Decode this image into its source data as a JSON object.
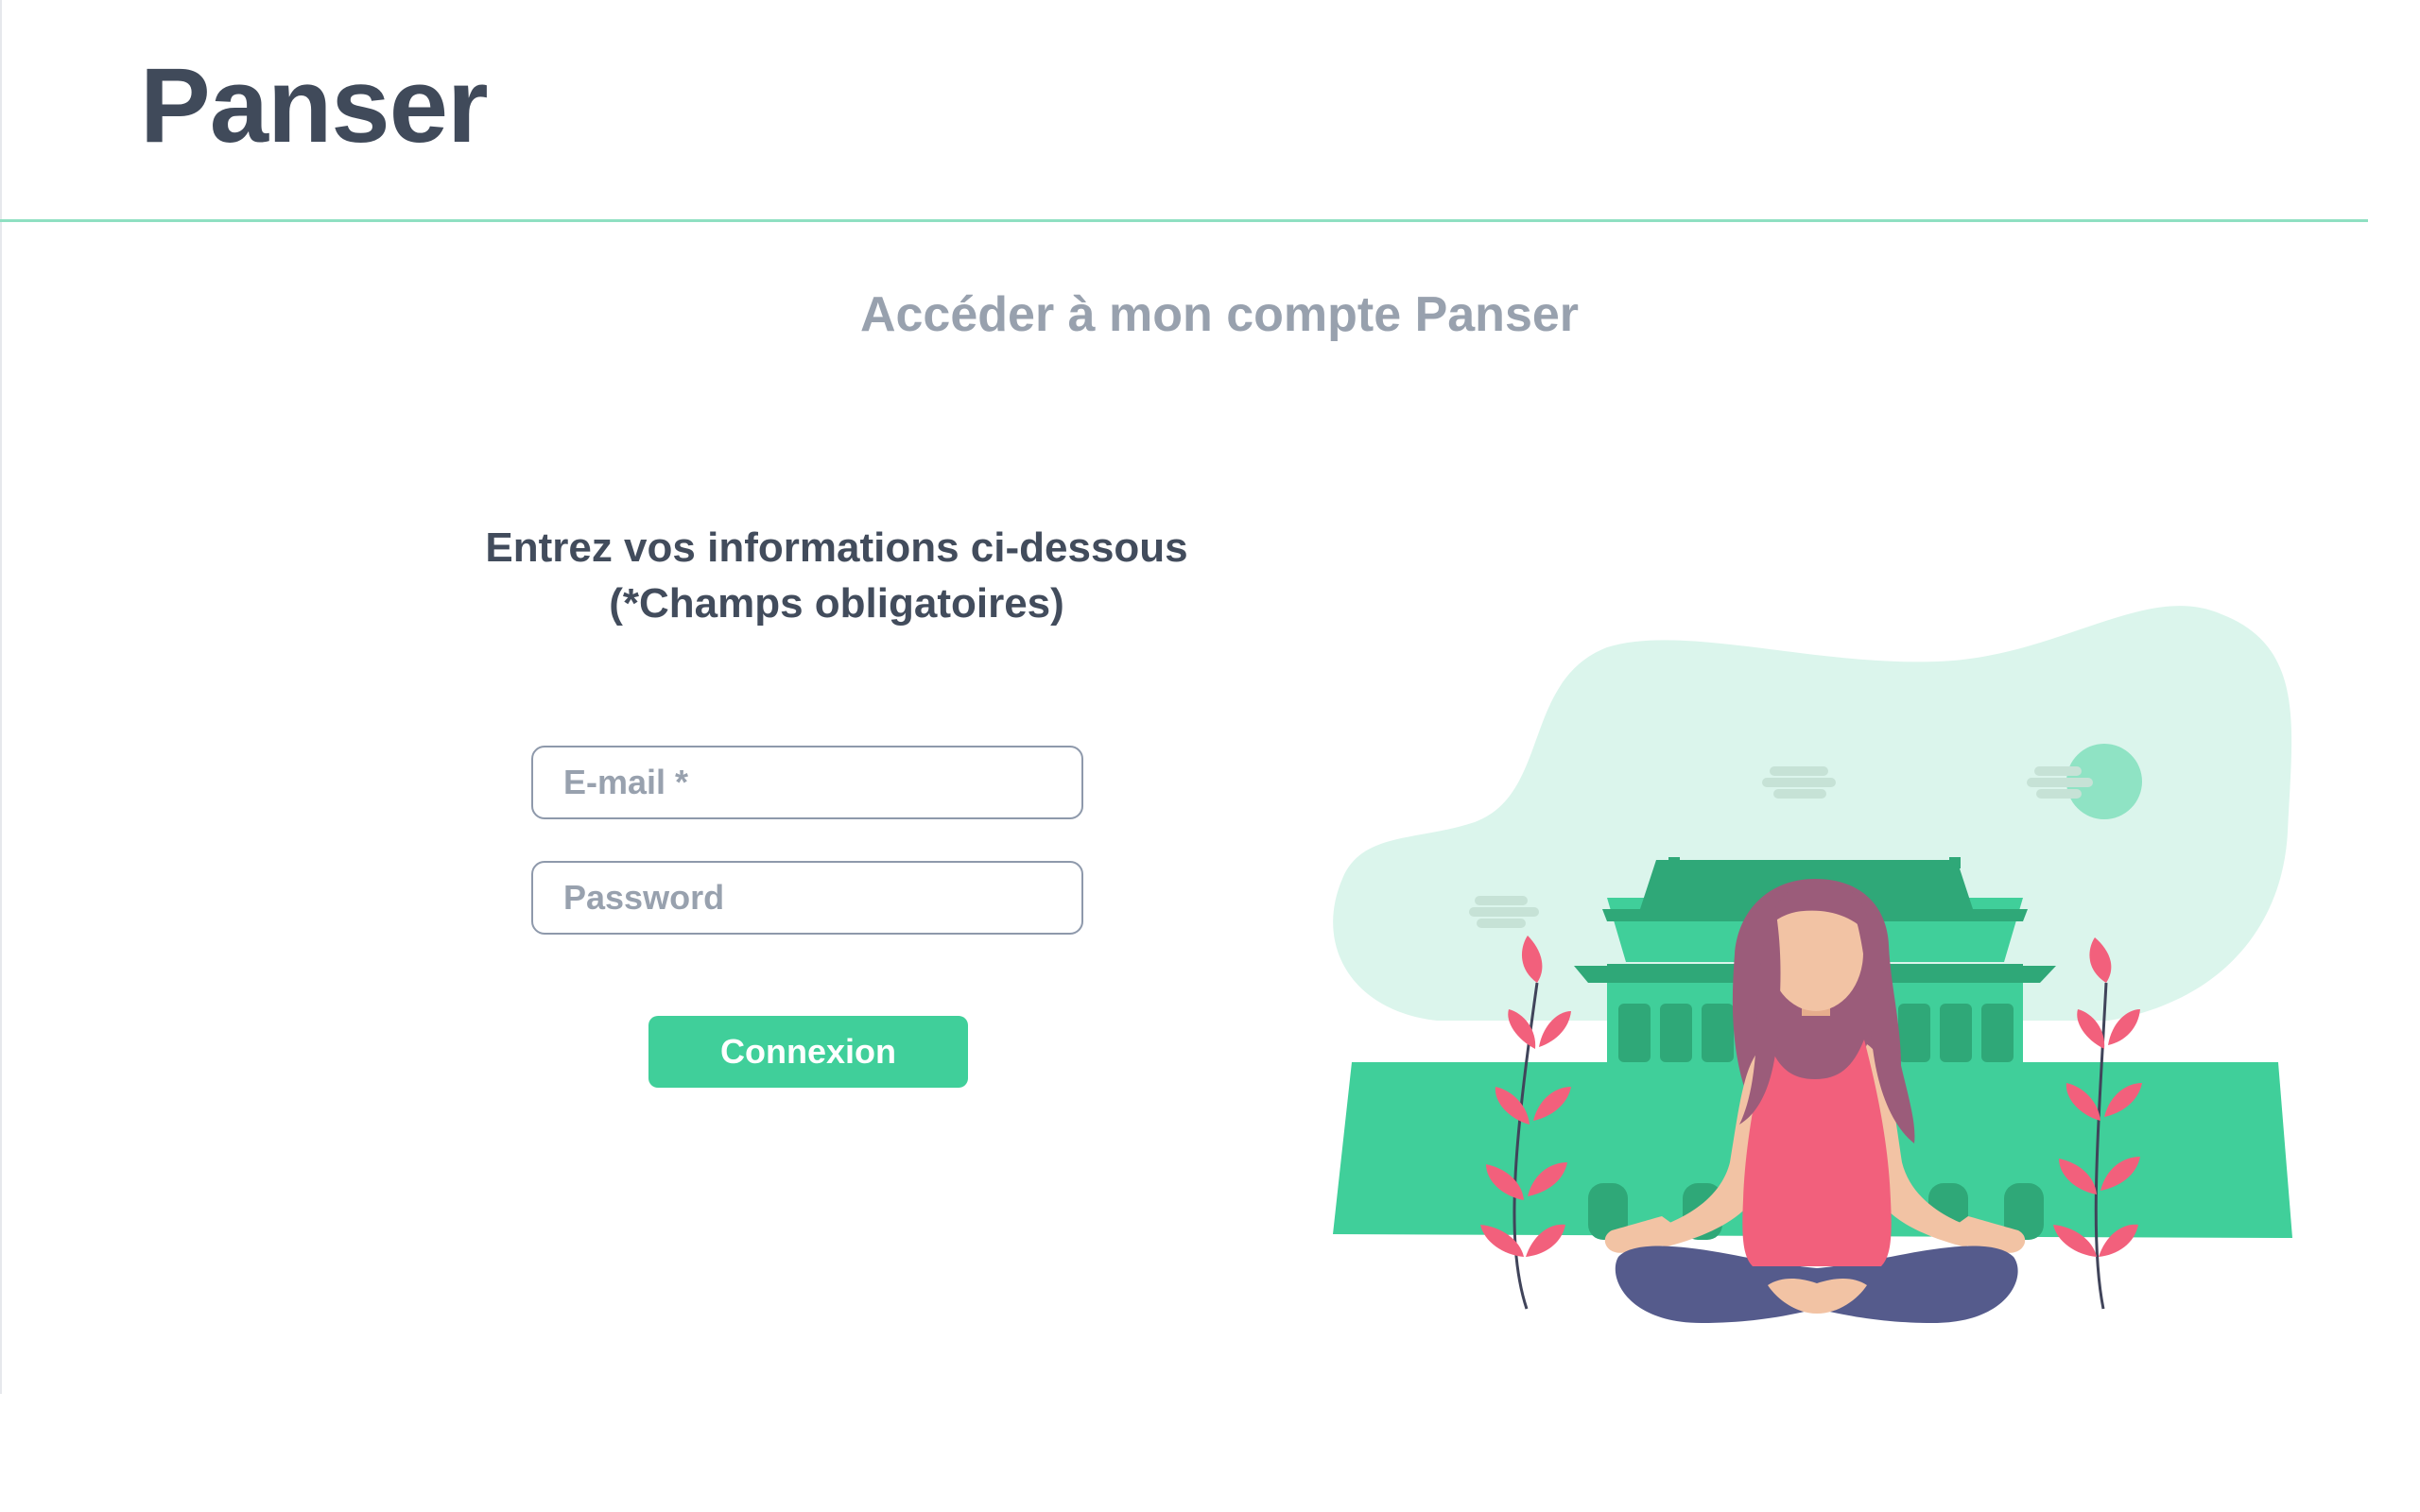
{
  "header": {
    "brand": "Panser"
  },
  "main": {
    "title": "Accéder à mon compte Panser",
    "form": {
      "heading_line1": "Entrez vos informations ci-dessous",
      "heading_line2": "(*Champs obligatoires)",
      "email": {
        "placeholder": "E-mail *",
        "value": ""
      },
      "password": {
        "placeholder": "Password",
        "value": ""
      },
      "submit_label": "Connexion"
    }
  },
  "illustration": {
    "subject": "meditation-illustration"
  },
  "colors": {
    "accent": "#40cf9a",
    "accent_light": "#dbf5ec",
    "text_dark": "#404a5a",
    "text_muted": "#98a1ae",
    "temple_dark": "#2fa878",
    "flower_pink": "#f2607c",
    "hair": "#9b5c7a",
    "skin": "#f2c3a4",
    "pants": "#555b8c"
  }
}
